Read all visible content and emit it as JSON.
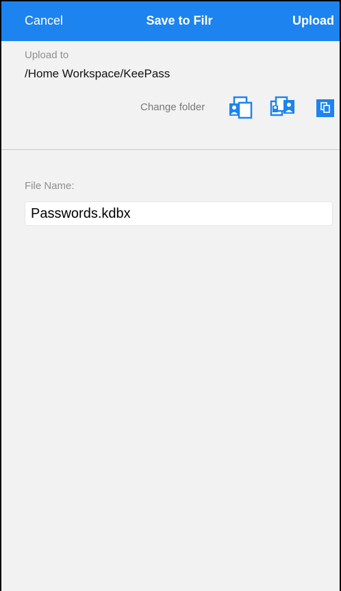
{
  "navbar": {
    "cancel_label": "Cancel",
    "title": "Save to Filr",
    "upload_label": "Upload",
    "background_color": "#1d83ee"
  },
  "upload": {
    "label": "Upload to",
    "path": "/Home Workspace/KeePass",
    "change_folder_label": "Change folder",
    "folder_buttons": [
      {
        "icon": "my-files-icon"
      },
      {
        "icon": "shared-with-me-icon"
      },
      {
        "icon": "net-folders-icon"
      }
    ]
  },
  "file": {
    "label": "File Name:",
    "value": "Passwords.kdbx"
  },
  "colors": {
    "accent": "#1d83ee",
    "background": "#f2f2f2"
  }
}
